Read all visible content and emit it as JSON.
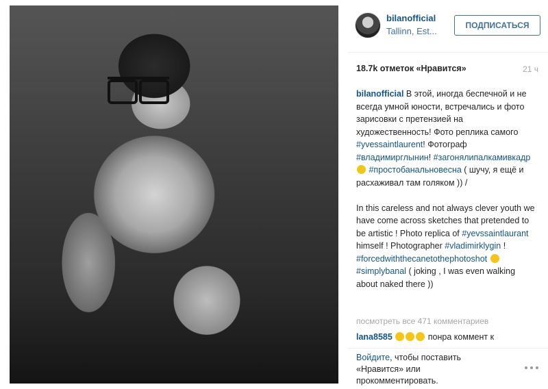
{
  "post": {
    "image_alt": "photo"
  },
  "header": {
    "username": "bilanofficial",
    "location": "Tallinn, Est...",
    "follow_label": "ПОДПИСАТЬСЯ"
  },
  "stats": {
    "likes": "18.7k отметок «Нравится»",
    "time": "21 ч"
  },
  "caption": {
    "username": "bilanofficial",
    "ru_1": " В этой, иногда беспечной и не всегда умной юности, встречались и фото зарисовки с претензией на художественность! Фото реплика самого ",
    "tag_1": "#yvessaintlaurent",
    "ru_2": "! Фотограф ",
    "tag_2": "#владимирглынин",
    "ru_3": "! ",
    "tag_3": "#загонялипалкамивкадр",
    "tag_4": "#простобанальновесна",
    "ru_4": " ( шучу, я ещё и расхаживал там голяком )) /",
    "en_1": "In this careless and not always clever youth we have come across sketches that pretended to be artistic ! Photo replica of ",
    "tag_5": "#yevssaintlaurant",
    "en_2": " himself ! Photographer ",
    "tag_6": "#vladimirklygin",
    "en_3": " ! ",
    "tag_7": "#forcedwiththecanetothephotoshot",
    "tag_8": "#simplybanal",
    "en_4": " ( joking , I was even walking about naked there ))"
  },
  "comments": {
    "view_all": "посмотреть все 471 комментариев",
    "first_user": "lana8585",
    "first_text": " понра коммент к"
  },
  "login": {
    "link": "Войдите",
    "text": ", чтобы поставить «Нравится» или прокомментировать."
  },
  "icons": {
    "more": "more-options-icon",
    "emoji": "sad-face-emoji-icon"
  }
}
